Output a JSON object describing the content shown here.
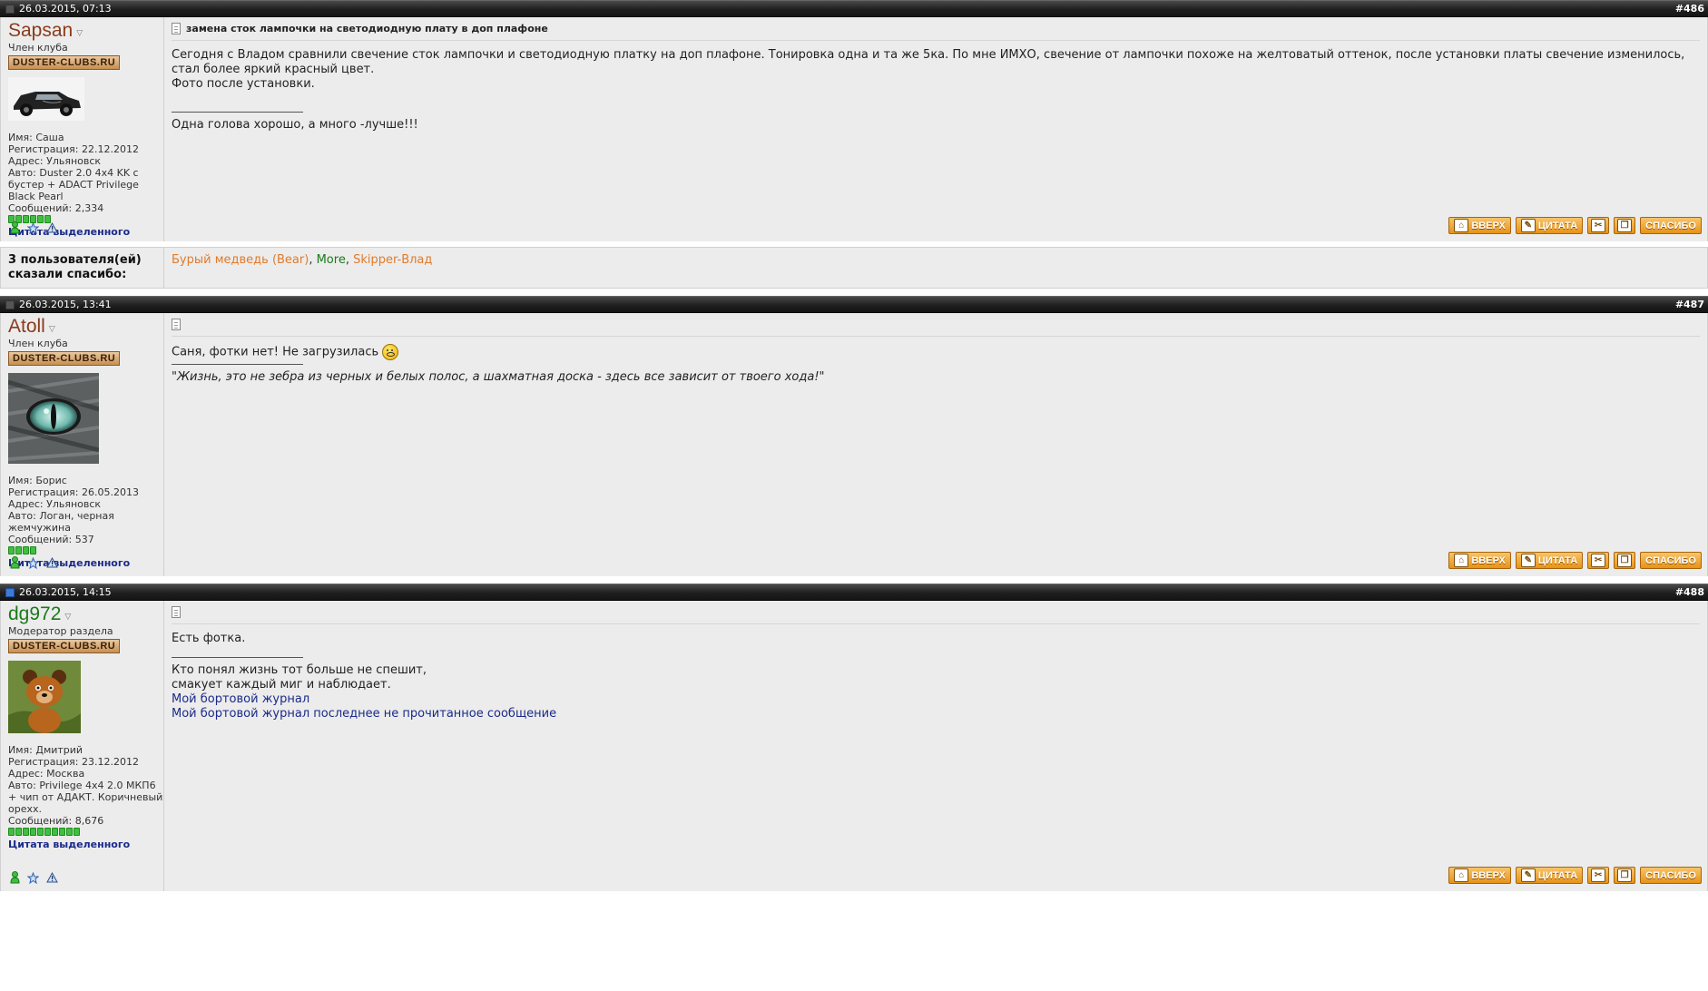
{
  "posts": [
    {
      "date": "26.03.2015, 07:13",
      "number": "#486",
      "is_new": false,
      "user": {
        "name": "Sapsan",
        "name_color": "brown",
        "title": "Член клуба",
        "badge": "DUSTER-CLUBS.RU",
        "info": [
          "Имя: Саша",
          "Регистрация: 22.12.2012",
          "Адрес: Ульяновск",
          "Авто: Duster 2.0 4x4 KK с бустер + ADACT Privilege Black Pearl",
          "Сообщений: 2,334"
        ],
        "rep_pips": 6
      },
      "title": "замена сток лампочки на светодиодную плату в доп плафоне",
      "body": [
        "Сегодня с Владом сравнили свечение сток лампочки и светодиодную платку на доп плафоне. Тонировка одна и та же 5ка. По мне ИМХО, свечение от лампочки похоже на желтоватый оттенок, после установки платы свечение изменилось, стал более яркий красный цвет.",
        "Фото после установки."
      ],
      "signature": [
        "Одна голова хорошо, а много -лучше!!!"
      ]
    },
    {
      "date": "26.03.2015, 13:41",
      "number": "#487",
      "is_new": false,
      "user": {
        "name": "Atoll",
        "name_color": "brown",
        "title": "Член клуба",
        "badge": "DUSTER-CLUBS.RU",
        "info": [
          "Имя: Борис",
          "Регистрация: 26.05.2013",
          "Адрес: Ульяновск",
          "Авто: Логан, черная жемчужина",
          "Сообщений: 537"
        ],
        "rep_pips": 4
      },
      "title": "",
      "body": [
        "Саня, фотки нет! Не загрузилась"
      ],
      "signature": [
        "\"Жизнь, это не зебра из черных и белых полос, а шахматная доска - здесь все зависит от твоего хода!\""
      ]
    },
    {
      "date": "26.03.2015, 14:15",
      "number": "#488",
      "is_new": true,
      "user": {
        "name": "dg972",
        "name_color": "green",
        "title": "Модератор раздела",
        "badge": "DUSTER-CLUBS.RU",
        "info": [
          "Имя: Дмитрий",
          "Регистрация: 23.12.2012",
          "Адрес: Москва",
          "Авто: Privilege 4x4 2.0 МКП6 + чип от АДАКТ. Коричневый орехх.",
          "Сообщений: 8,676"
        ],
        "rep_pips": 10
      },
      "title": "",
      "body": [
        "Есть фотка."
      ],
      "signature": [
        "Кто понял жизнь тот больше не спешит,",
        "смакует каждый миг и наблюдает."
      ],
      "signature_links": [
        "Мой бортовой журнал",
        "Мой бортовой журнал последнее не прочитанное сообщение"
      ]
    }
  ],
  "quote_selected_label": "Цитата выделенного",
  "buttons": {
    "up": "ВВЕРХ",
    "quote": "ЦИТАТА",
    "thanks": "СПАСИБО"
  },
  "thanks_block": {
    "label": "3 пользователя(ей) сказали спасибо:",
    "users": [
      "Бурый медведь (Bear)",
      "More",
      "Skipper-Влад"
    ]
  },
  "colors": {
    "header_bar": "#1f1f1f",
    "post_bg": "#ececec",
    "button_orange": "#e89317"
  }
}
